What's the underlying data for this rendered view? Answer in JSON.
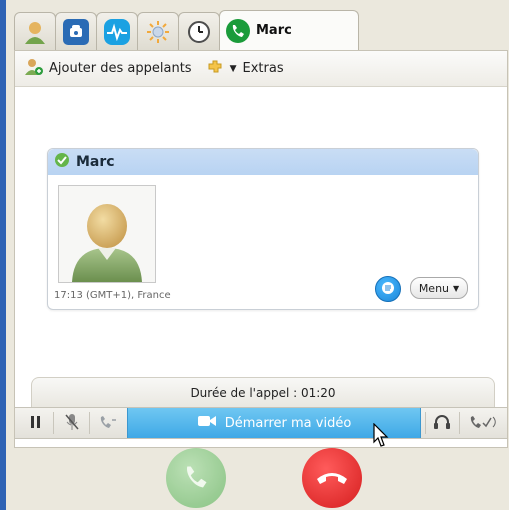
{
  "tabs": [
    {
      "icon": "contacts-icon"
    },
    {
      "icon": "phone-icon"
    },
    {
      "icon": "activity-icon"
    },
    {
      "icon": "sun-icon"
    },
    {
      "icon": "clock-icon"
    },
    {
      "icon": "call-icon",
      "label": "Marc"
    }
  ],
  "toolbar": {
    "add_callers_label": "Ajouter des appelants",
    "extras_label": "Extras"
  },
  "contact_card": {
    "name": "Marc",
    "local_time": "17:13 (GMT+1), France",
    "menu_label": "Menu"
  },
  "call": {
    "duration_text": "Durée de l'appel : 01:20",
    "start_video_label": "Démarrer ma vidéo"
  },
  "colors": {
    "video_button": "#3fa8e6",
    "hangup": "#d51e1e",
    "accept": "#7fbf7a",
    "card_header": "#b8d3f2"
  }
}
